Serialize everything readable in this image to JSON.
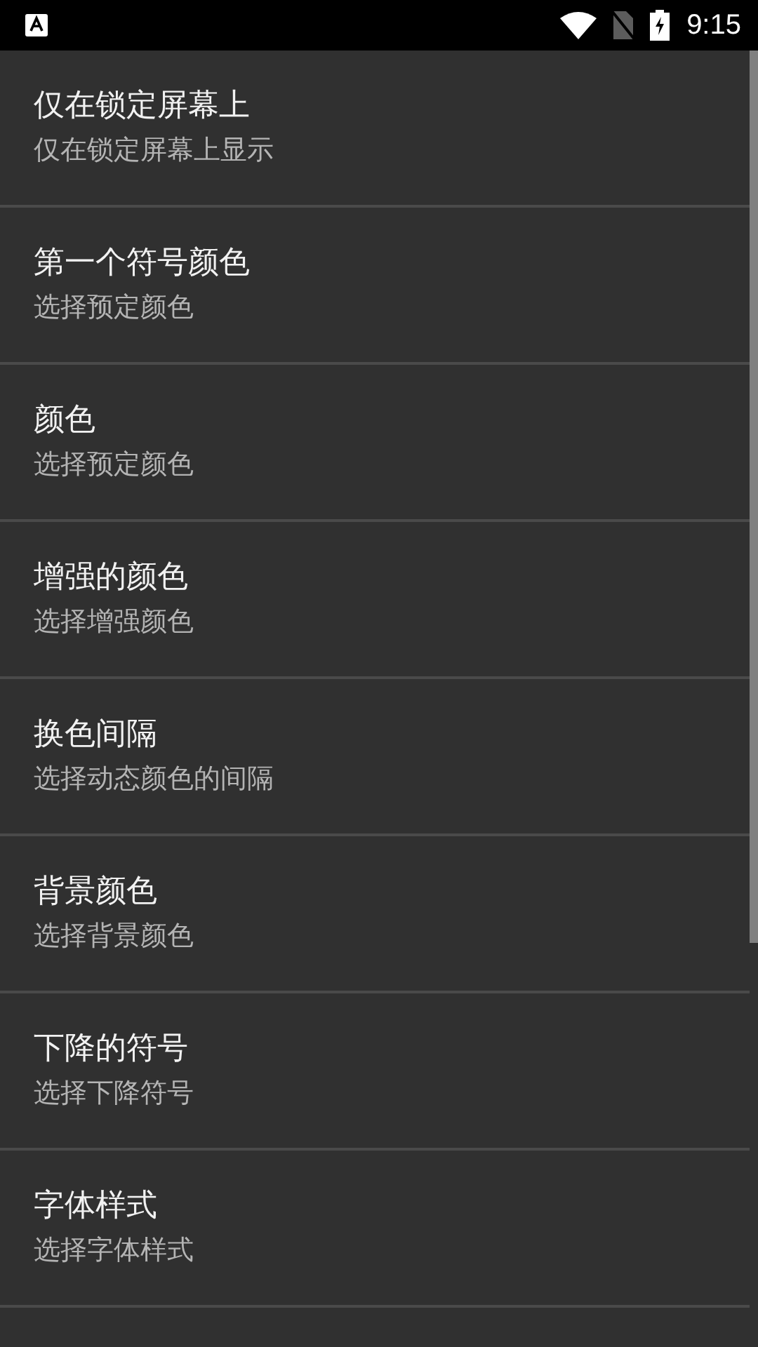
{
  "status_bar": {
    "time": "9:15"
  },
  "settings": [
    {
      "title": "仅在锁定屏幕上",
      "subtitle": "仅在锁定屏幕上显示"
    },
    {
      "title": "第一个符号颜色",
      "subtitle": "选择预定颜色"
    },
    {
      "title": "颜色",
      "subtitle": "选择预定颜色"
    },
    {
      "title": "增强的颜色",
      "subtitle": "选择增强颜色"
    },
    {
      "title": "换色间隔",
      "subtitle": "选择动态颜色的间隔"
    },
    {
      "title": "背景颜色",
      "subtitle": "选择背景颜色"
    },
    {
      "title": "下降的符号",
      "subtitle": "选择下降符号"
    },
    {
      "title": "字体样式",
      "subtitle": "选择字体样式"
    }
  ]
}
